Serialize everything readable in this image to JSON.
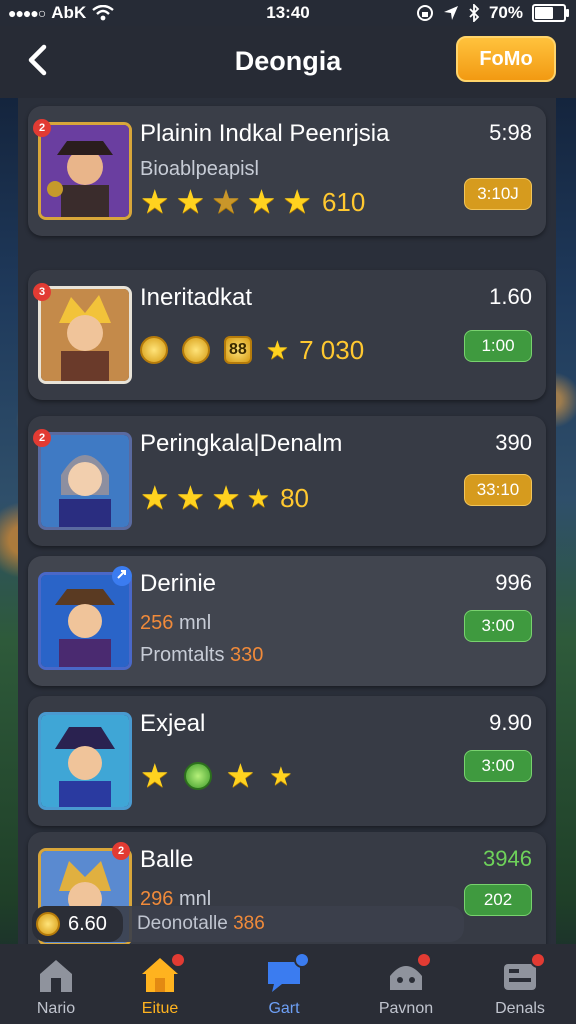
{
  "status_bar": {
    "carrier": "AbK",
    "time": "13:40",
    "battery": "70%",
    "battery_level": 0.7
  },
  "header": {
    "back_icon": "chevron-left-icon",
    "title": "Deongia",
    "promo_label": "FoMo"
  },
  "colors": {
    "accent": "#ffb31f",
    "badge": "#e23b33",
    "gold_pill": "#d69b1e",
    "green_pill": "#3f9a3f"
  },
  "cards": [
    {
      "badge": "2",
      "title": "Plainin Indkal Peenrjsia",
      "subtitle": "Bioablpeapisl",
      "rating_value": "610",
      "time": "5:98",
      "pill": "3:10J"
    },
    {
      "badge": "3",
      "title": "Ineritadkat",
      "rating_value": "7 030",
      "coin_text": "88",
      "time": "1.60",
      "pill": "1:00"
    },
    {
      "badge": "2",
      "title": "Peringkala|Denalm",
      "rating_value": "80",
      "time": "390",
      "pill": "33:10"
    },
    {
      "badge": "",
      "title": "Derinie",
      "sub_value": "256",
      "sub_unit": "mnl",
      "sub2_text": "Promtalts",
      "sub2_value": "330",
      "time": "996",
      "pill": "3:00"
    },
    {
      "badge": "",
      "title": "Exjeal",
      "time": "9.90",
      "pill": "3:00"
    },
    {
      "badge": "2",
      "title": "Balle",
      "sub_value": "296",
      "sub_unit": "mnl",
      "time": "3946",
      "pill": "202"
    }
  ],
  "summary": {
    "left_value": "6.60",
    "right_text": "Deonotalle",
    "right_value": "386"
  },
  "tabs": [
    {
      "label": "Nario",
      "icon": "home-icon"
    },
    {
      "label": "Eitue",
      "icon": "house-gold-icon"
    },
    {
      "label": "Gart",
      "icon": "chat-icon"
    },
    {
      "label": "Pavnon",
      "icon": "dice-icon"
    },
    {
      "label": "Denals",
      "icon": "controller-icon"
    }
  ]
}
